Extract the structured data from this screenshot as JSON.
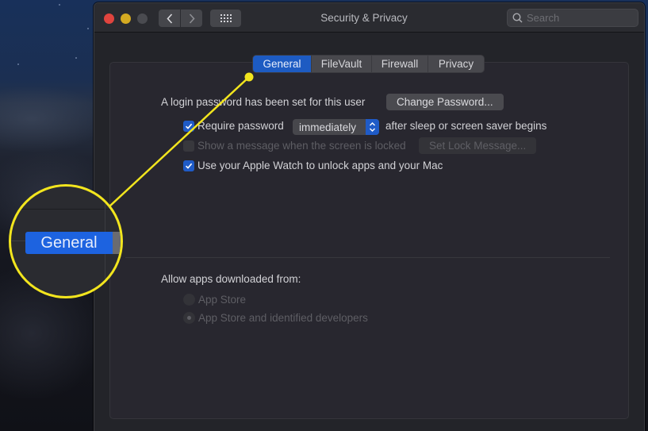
{
  "window": {
    "title": "Security & Privacy",
    "search_placeholder": "Search",
    "nav": {
      "back_icon": "chevron-left-icon",
      "forward_icon": "chevron-right-icon",
      "show_all_icon": "grid-icon"
    }
  },
  "tabs": [
    {
      "label": "General",
      "active": true
    },
    {
      "label": "FileVault",
      "active": false
    },
    {
      "label": "Firewall",
      "active": false
    },
    {
      "label": "Privacy",
      "active": false
    }
  ],
  "general": {
    "login_password_text": "A login password has been set for this user",
    "change_password_button": "Change Password...",
    "require_password": {
      "label": "Require password",
      "checked": true,
      "delay_value": "immediately",
      "suffix": "after sleep or screen saver begins"
    },
    "show_message": {
      "label": "Show a message when the screen is locked",
      "checked": false,
      "enabled": false,
      "button": "Set Lock Message..."
    },
    "apple_watch": {
      "label": "Use your Apple Watch to unlock apps and your Mac",
      "checked": true
    },
    "allow_apps": {
      "label": "Allow apps downloaded from:",
      "options": [
        {
          "label": "App Store",
          "selected": false
        },
        {
          "label": "App Store and identified developers",
          "selected": true
        }
      ],
      "enabled": false
    }
  },
  "annotation": {
    "magnified_label": "General",
    "highlight_color": "#f2e51e"
  },
  "colors": {
    "accent": "#1f5bc7",
    "close": "#e0443e",
    "minimize": "#d4aa21",
    "zoom": "#4a4b50"
  }
}
